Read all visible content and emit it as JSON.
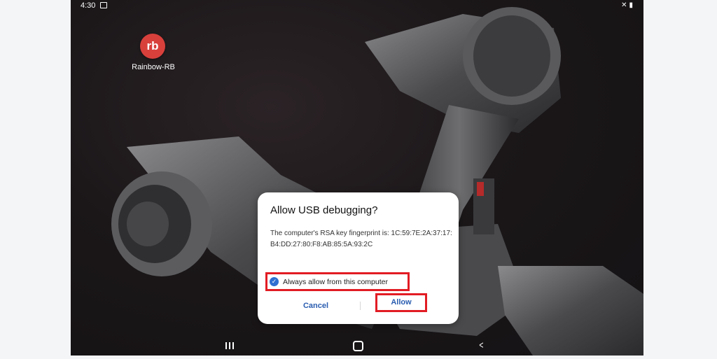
{
  "status_bar": {
    "time": "4:30",
    "left_icon": "image-icon",
    "right_icons": [
      "mute-icon",
      "battery-icon"
    ]
  },
  "home_screen": {
    "app_icon_text": "rb",
    "app_label": "Rainbow-RB"
  },
  "dialog": {
    "title": "Allow USB debugging?",
    "message": "The computer's RSA key fingerprint is: 1C:59:7E:2A:37:17:B4:DD:27:80:F8:AB:85:5A:93:2C",
    "checkbox_label": "Always allow from this computer",
    "checkbox_checked": true,
    "cancel_label": "Cancel",
    "allow_label": "Allow"
  },
  "nav_bar": {
    "recents": "recents-icon",
    "home": "home-icon",
    "back": "back-icon"
  },
  "colors": {
    "highlight": "#e21c24",
    "accent": "#2a5db0",
    "app_icon": "#d8403c"
  }
}
